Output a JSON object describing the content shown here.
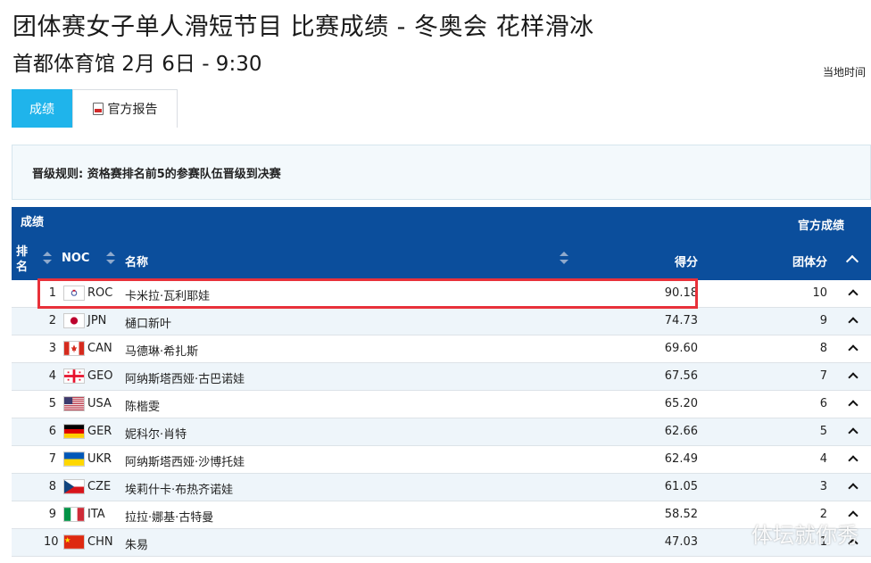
{
  "page": {
    "title": "团体赛女子单人滑短节目 比赛成绩 - 冬奥会 花样滑冰",
    "subtitle": "首都体育馆 2月 6日 - 9:30",
    "local_time_label": "当地时间"
  },
  "tabs": [
    {
      "label": "成绩",
      "active": true
    },
    {
      "label": "官方报告",
      "active": false,
      "icon": "pdf-icon"
    }
  ],
  "qualification_rule": "晋级规则: 资格赛排名前5的参赛队伍晋级到决赛",
  "table": {
    "section_label": "成绩",
    "official_label": "官方成绩",
    "columns": {
      "rank": "排名",
      "noc": "NOC",
      "name": "名称",
      "score": "得分",
      "team_points": "团体分"
    },
    "rows": [
      {
        "rank": "1",
        "noc": "ROC",
        "name": "卡米拉·瓦利耶娃",
        "score": "90.18",
        "points": "10",
        "flag": "roc",
        "highlighted": true
      },
      {
        "rank": "2",
        "noc": "JPN",
        "name": "樋口新叶",
        "score": "74.73",
        "points": "9",
        "flag": "jpn"
      },
      {
        "rank": "3",
        "noc": "CAN",
        "name": "马德琳·希扎斯",
        "score": "69.60",
        "points": "8",
        "flag": "can"
      },
      {
        "rank": "4",
        "noc": "GEO",
        "name": "阿纳斯塔西娅·古巴诺娃",
        "score": "67.56",
        "points": "7",
        "flag": "geo"
      },
      {
        "rank": "5",
        "noc": "USA",
        "name": "陈楷雯",
        "score": "65.20",
        "points": "6",
        "flag": "usa"
      },
      {
        "rank": "6",
        "noc": "GER",
        "name": "妮科尔·肖特",
        "score": "62.66",
        "points": "5",
        "flag": "ger"
      },
      {
        "rank": "7",
        "noc": "UKR",
        "name": "阿纳斯塔西娅·沙博托娃",
        "score": "62.49",
        "points": "4",
        "flag": "ukr"
      },
      {
        "rank": "8",
        "noc": "CZE",
        "name": "埃莉什卡·布热齐诺娃",
        "score": "61.05",
        "points": "3",
        "flag": "cze"
      },
      {
        "rank": "9",
        "noc": "ITA",
        "name": "拉拉·娜基·古特曼",
        "score": "58.52",
        "points": "2",
        "flag": "ita"
      },
      {
        "rank": "10",
        "noc": "CHN",
        "name": "朱易",
        "score": "47.03",
        "points": "1",
        "flag": "chn"
      }
    ]
  },
  "watermark": "体坛就你秀",
  "colors": {
    "header_blue": "#0b4e9c",
    "tab_active": "#1fb4eb",
    "highlight_red": "#e8313a",
    "row_alt": "#eef5fa"
  }
}
